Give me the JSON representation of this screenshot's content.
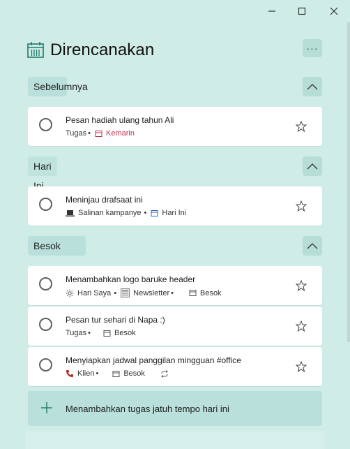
{
  "window": {
    "minimize_icon": "minimize-icon",
    "maximize_icon": "maximize-icon",
    "close_icon": "close-icon"
  },
  "header": {
    "title": "Direncanakan",
    "icon": "calendar-icon",
    "more_label": "···"
  },
  "groups": [
    {
      "label": "Sebelumnya",
      "tasks": [
        {
          "title": "Pesan hadiah ulang tahun Ali",
          "list": "Tugas",
          "sep": "•",
          "due": "Kemarin",
          "due_color": "#c4314b"
        }
      ]
    },
    {
      "label": "Hari Ini",
      "tasks": [
        {
          "title": "Meninjau drafsaat ini",
          "list": "Salinan kampanye",
          "sep": "•",
          "due": "Hari Ini",
          "due_color": "#2a64c4"
        }
      ]
    },
    {
      "label": "Besok",
      "tasks": [
        {
          "title": "Menambahkan logo baruke header",
          "list": "Hari Saya",
          "sep": "•",
          "list2": "Newsletter",
          "sep2": "•",
          "due": "Besok"
        },
        {
          "title": "Pesan tur sehari di Napa :)",
          "list": "Tugas",
          "sep": "•",
          "due": "Besok"
        },
        {
          "title": "Menyiapkan jadwal panggilan mingguan #office",
          "list": "Klien",
          "sep": "•",
          "due": "Besok",
          "repeat_icon": "repeat-icon"
        }
      ]
    }
  ],
  "add_task": {
    "label": "Menambahkan tugas jatuh tempo hari ini"
  },
  "colors": {
    "accent": "#1f7a6b",
    "background": "#cfece7",
    "overdue": "#c4314b",
    "today": "#2a64c4"
  }
}
